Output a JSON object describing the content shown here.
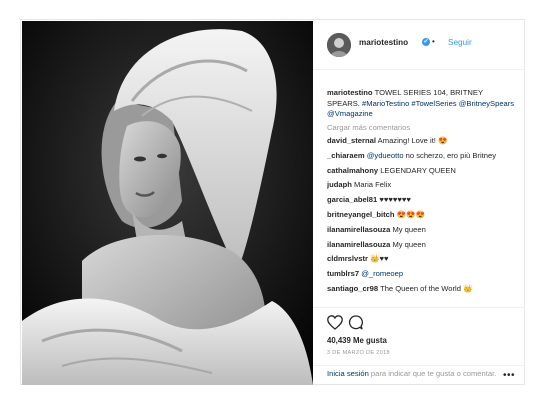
{
  "post": {
    "username": "mariotestino",
    "follow_label": "Seguir",
    "caption_user": "mariotestino",
    "caption_text": "TOWEL SERIES 104, BRITNEY SPEARS.",
    "caption_tags": "#MarioTestino #TowelSeries @BritneySpears @Vmagazine",
    "load_more": "Cargar más comentarios",
    "comments": [
      {
        "user": "david_sternal",
        "mention": "",
        "text": "Amazing! Love it! 😍"
      },
      {
        "user": "_chiaraem",
        "mention": "@ydueotto",
        "text": "no scherzo, ero più Britney"
      },
      {
        "user": "cathalmahony",
        "mention": "",
        "text": "LEGENDARY QUEEN"
      },
      {
        "user": "judaph",
        "mention": "",
        "text": "Maria Felix"
      },
      {
        "user": "garcia_abel81",
        "mention": "",
        "text": "♥♥♥♥♥♥♥"
      },
      {
        "user": "britneyangel_bitch",
        "mention": "",
        "text": "😍😍😍"
      },
      {
        "user": "ilanamirellasouza",
        "mention": "",
        "text": "My queen"
      },
      {
        "user": "ilanamirellasouza",
        "mention": "",
        "text": "My queen"
      },
      {
        "user": "cldmrslvstr",
        "mention": "",
        "text": "👑♥♥"
      },
      {
        "user": "tumblrs7",
        "mention": "@_romeoep",
        "text": ""
      },
      {
        "user": "santiago_cr98",
        "mention": "",
        "text": "The Queen of the World 👑"
      }
    ],
    "likes": "40,439 Me gusta",
    "date": "3 DE MARZO DE 2018",
    "login_link": "Inicia sesión",
    "login_text": "para indicar que te gusta o comentar.",
    "more_label": "•••",
    "verified_glyph": "✔",
    "dot_glyph": "•"
  },
  "colors": {
    "link": "#3897f0",
    "mention": "#003569",
    "muted": "#999999",
    "text": "#262626",
    "border": "#e6e6e6"
  },
  "icons": {
    "verified": "verified-badge-icon",
    "like": "heart-icon",
    "comment": "comment-bubble-icon",
    "more": "more-options-icon"
  }
}
